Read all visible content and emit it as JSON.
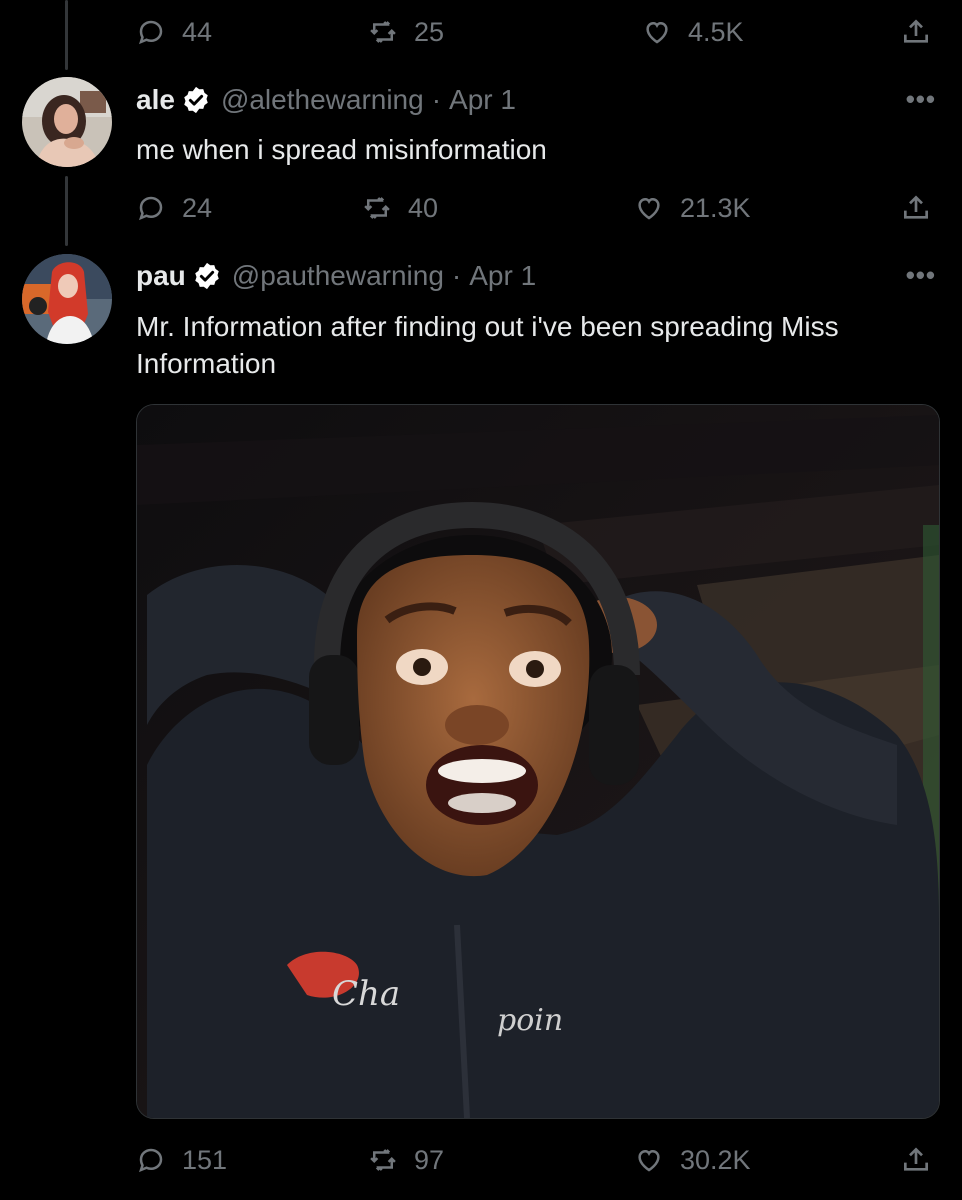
{
  "thread_top": {
    "actions": {
      "replies": "44",
      "retweets": "25",
      "likes": "4.5K"
    }
  },
  "tweet1": {
    "display_name": "ale",
    "handle": "@alethewarning",
    "separator": "·",
    "date": "Apr 1",
    "text": "me when i spread misinformation",
    "actions": {
      "replies": "24",
      "retweets": "40",
      "likes": "21.3K"
    }
  },
  "tweet2": {
    "display_name": "pau",
    "handle": "@pauthewarning",
    "separator": "·",
    "date": "Apr 1",
    "text": "Mr. Information after finding out i've been spreading Miss Information",
    "actions": {
      "replies": "151",
      "retweets": "97",
      "likes": "30.2K"
    }
  },
  "more_menu": "•••",
  "icons": [
    "reply-icon",
    "retweet-icon",
    "like-icon",
    "share-icon",
    "verified-badge-icon",
    "more-icon"
  ],
  "colors": {
    "background": "#000000",
    "text": "#e7e9ea",
    "muted": "#71767b",
    "badge": "#ffffff"
  }
}
